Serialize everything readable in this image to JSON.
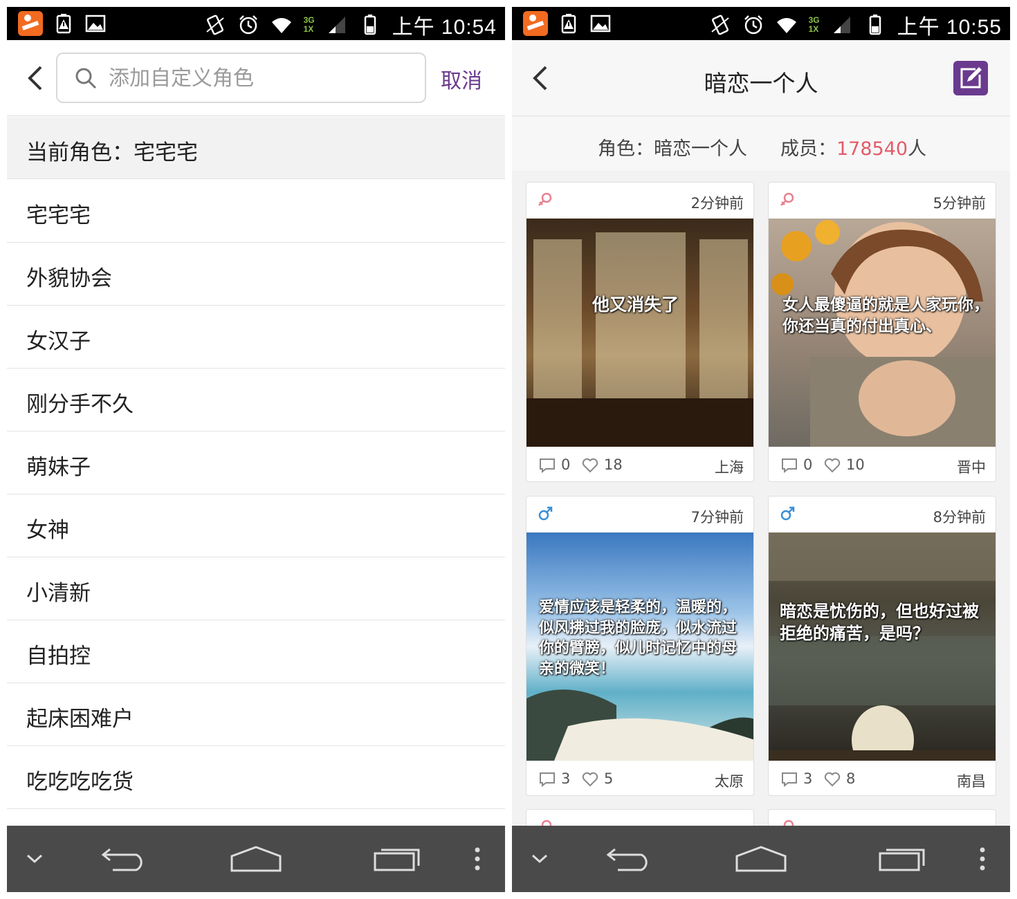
{
  "left": {
    "status": {
      "time": "上午 10:54",
      "net_top": "3G",
      "net_bottom": "1X"
    },
    "search": {
      "placeholder": "添加自定义角色",
      "cancel": "取消"
    },
    "current_role": "当前角色：宅宅宅",
    "roles": [
      "宅宅宅",
      "外貌协会",
      "女汉子",
      "刚分手不久",
      "萌妹子",
      "女神",
      "小清新",
      "自拍控",
      "起床困难户",
      "吃吃吃吃货"
    ]
  },
  "right": {
    "status": {
      "time": "上午 10:55",
      "net_top": "3G",
      "net_bottom": "1X"
    },
    "title": "暗恋一个人",
    "info": {
      "role_label": "角色：暗恋一个人",
      "member_label": "成员：",
      "member_count": "178540",
      "member_unit": "人"
    },
    "posts": [
      {
        "gender": "female",
        "time": "2分钟前",
        "text": "他又消失了",
        "comments": "0",
        "likes": "18",
        "city": "上海"
      },
      {
        "gender": "female",
        "time": "5分钟前",
        "text": "女人最傻逼的就是人家玩你，你还当真的付出真心、",
        "comments": "0",
        "likes": "10",
        "city": "晋中"
      },
      {
        "gender": "male",
        "time": "7分钟前",
        "text": "爱情应该是轻柔的，温暖的，似风拂过我的脸庞，似水流过你的臂膀，似儿时记忆中的母亲的微笑！",
        "comments": "3",
        "likes": "5",
        "city": "太原"
      },
      {
        "gender": "male",
        "time": "8分钟前",
        "text": "暗恋是忧伤的，但也好过被拒绝的痛苦，是吗？",
        "comments": "3",
        "likes": "8",
        "city": "南昌"
      }
    ]
  },
  "colors": {
    "accent": "#6a3a8e",
    "female": "#e8808f",
    "male": "#3a8fd6",
    "count": "#e35b6a",
    "navbar": "#4a4a4a"
  }
}
